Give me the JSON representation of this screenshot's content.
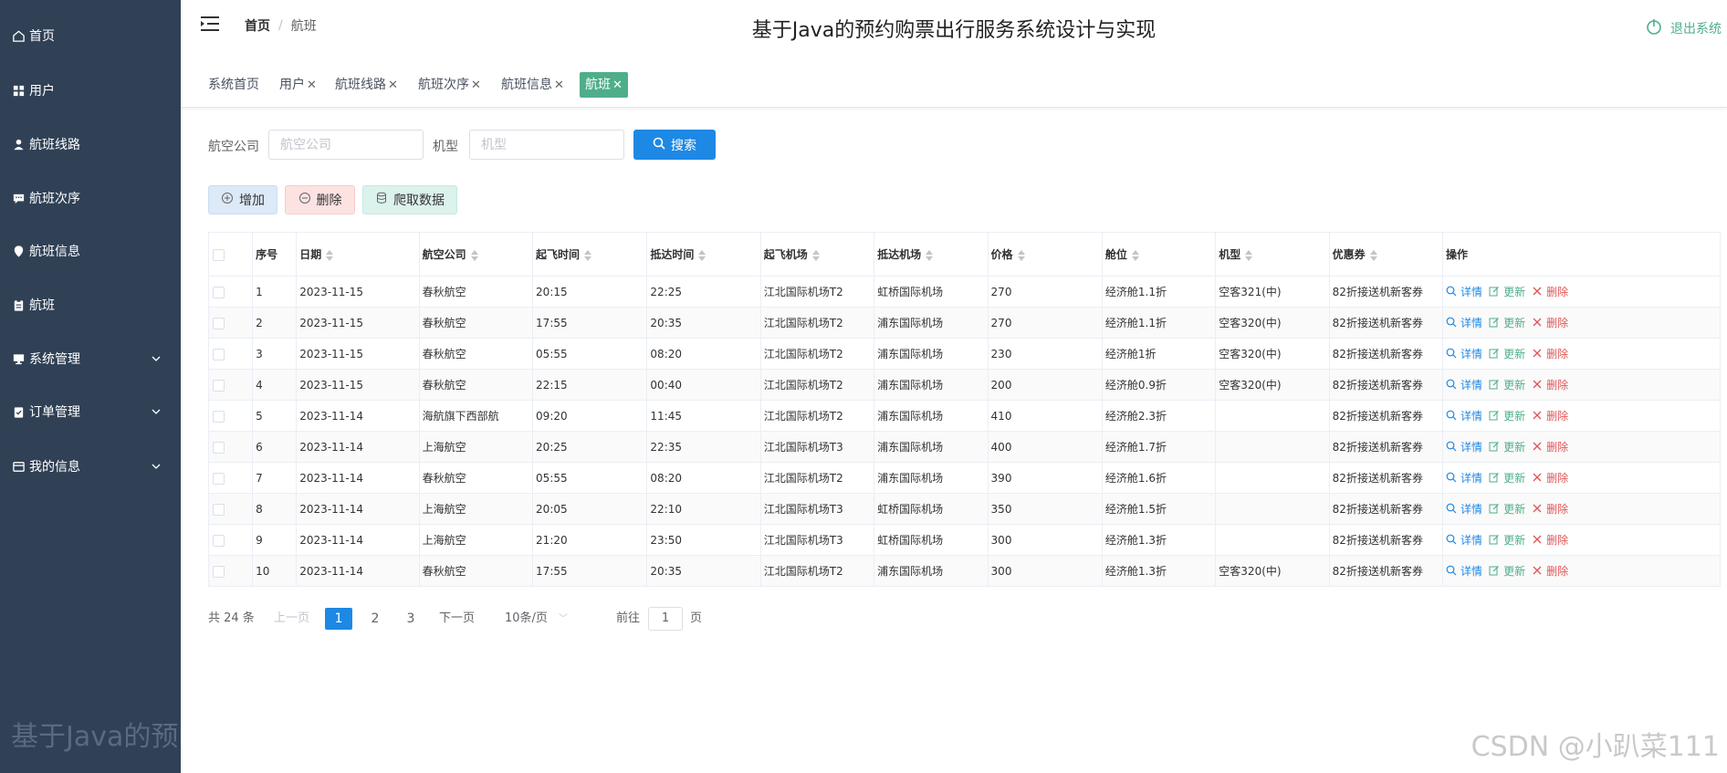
{
  "sidebar": {
    "items": [
      {
        "label": "首页",
        "icon": "home-icon"
      },
      {
        "label": "用户",
        "icon": "grid-icon"
      },
      {
        "label": "航班线路",
        "icon": "user-icon"
      },
      {
        "label": "航班次序",
        "icon": "message-icon"
      },
      {
        "label": "航班信息",
        "icon": "pin-icon"
      },
      {
        "label": "航班",
        "icon": "clipboard-icon"
      },
      {
        "label": "系统管理",
        "icon": "monitor-icon",
        "expandable": true
      },
      {
        "label": "订单管理",
        "icon": "checklist-icon",
        "expandable": true
      },
      {
        "label": "我的信息",
        "icon": "card-icon",
        "expandable": true
      }
    ],
    "watermark": "基于Java的预"
  },
  "header": {
    "breadcrumb_home": "首页",
    "breadcrumb_sep": "/",
    "breadcrumb_current": "航班",
    "title": "基于Java的预约购票出行服务系统设计与实现",
    "logout_label": "退出系统"
  },
  "tabs": [
    {
      "label": "系统首页",
      "closable": false
    },
    {
      "label": "用户",
      "closable": true
    },
    {
      "label": "航班线路",
      "closable": true
    },
    {
      "label": "航班次序",
      "closable": true
    },
    {
      "label": "航班信息",
      "closable": true
    },
    {
      "label": "航班",
      "closable": true,
      "active": true
    }
  ],
  "tab_close": "✕",
  "search": {
    "airline_label": "航空公司",
    "airline_placeholder": "航空公司",
    "model_label": "机型",
    "model_placeholder": "机型",
    "button_label": "搜索"
  },
  "actions": {
    "add_label": "增加",
    "delete_label": "删除",
    "crawl_label": "爬取数据"
  },
  "table": {
    "columns": [
      "序号",
      "日期",
      "航空公司",
      "起飞时间",
      "抵达时间",
      "起飞机场",
      "抵达机场",
      "价格",
      "舱位",
      "机型",
      "优惠券",
      "操作"
    ],
    "ops": {
      "detail": "详情",
      "update": "更新",
      "delete": "删除"
    },
    "rows": [
      [
        "1",
        "2023-11-15",
        "春秋航空",
        "20:15",
        "22:25",
        "江北国际机场T2",
        "虹桥国际机场",
        "270",
        "经济舱1.1折",
        "空客321(中)",
        "82折接送机新客券"
      ],
      [
        "2",
        "2023-11-15",
        "春秋航空",
        "17:55",
        "20:35",
        "江北国际机场T2",
        "浦东国际机场",
        "270",
        "经济舱1.1折",
        "空客320(中)",
        "82折接送机新客券"
      ],
      [
        "3",
        "2023-11-15",
        "春秋航空",
        "05:55",
        "08:20",
        "江北国际机场T2",
        "浦东国际机场",
        "230",
        "经济舱1折",
        "空客320(中)",
        "82折接送机新客券"
      ],
      [
        "4",
        "2023-11-15",
        "春秋航空",
        "22:15",
        "00:40",
        "江北国际机场T2",
        "浦东国际机场",
        "200",
        "经济舱0.9折",
        "空客320(中)",
        "82折接送机新客券"
      ],
      [
        "5",
        "2023-11-14",
        "海航旗下西部航",
        "09:20",
        "11:45",
        "江北国际机场T2",
        "浦东国际机场",
        "410",
        "经济舱2.3折",
        "",
        "82折接送机新客券"
      ],
      [
        "6",
        "2023-11-14",
        "上海航空",
        "20:25",
        "22:35",
        "江北国际机场T3",
        "浦东国际机场",
        "400",
        "经济舱1.7折",
        "",
        "82折接送机新客券"
      ],
      [
        "7",
        "2023-11-14",
        "春秋航空",
        "05:55",
        "08:20",
        "江北国际机场T2",
        "浦东国际机场",
        "390",
        "经济舱1.6折",
        "",
        "82折接送机新客券"
      ],
      [
        "8",
        "2023-11-14",
        "上海航空",
        "20:05",
        "22:10",
        "江北国际机场T3",
        "虹桥国际机场",
        "350",
        "经济舱1.5折",
        "",
        "82折接送机新客券"
      ],
      [
        "9",
        "2023-11-14",
        "上海航空",
        "21:20",
        "23:50",
        "江北国际机场T3",
        "虹桥国际机场",
        "300",
        "经济舱1.3折",
        "",
        "82折接送机新客券"
      ],
      [
        "10",
        "2023-11-14",
        "春秋航空",
        "17:55",
        "20:35",
        "江北国际机场T2",
        "浦东国际机场",
        "300",
        "经济舱1.3折",
        "空客320(中)",
        "82折接送机新客券"
      ]
    ]
  },
  "pagination": {
    "total_text": "共 24 条",
    "prev_label": "上一页",
    "pages": [
      "1",
      "2",
      "3"
    ],
    "current_page": "1",
    "next_label": "下一页",
    "page_size": "10条/页",
    "goto_label": "前往",
    "goto_value": "1",
    "page_unit": "页"
  },
  "watermark": "CSDN @小趴菜111",
  "colors": {
    "sidebar_bg": "#304156",
    "accent_green": "#4fae8a",
    "primary_blue": "#1e88e5",
    "danger_red": "#e05656"
  }
}
